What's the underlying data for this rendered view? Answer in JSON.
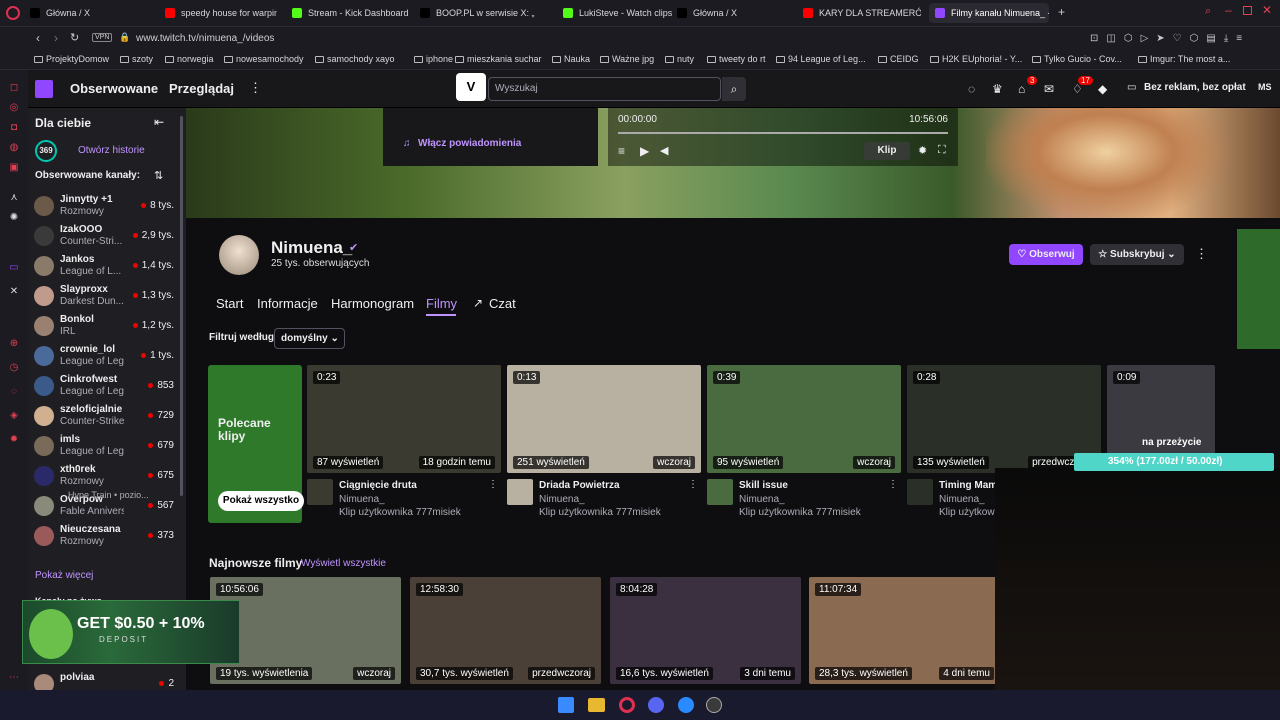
{
  "tabs": [
    {
      "label": "Główna / X",
      "color": "#000000"
    },
    {
      "label": "speedy house for warpin",
      "color": "#ff0000"
    },
    {
      "label": "Stream - Kick Dashboard",
      "color": "#53fc18"
    },
    {
      "label": "BOOP.PL w serwisie X: „",
      "color": "#000000"
    },
    {
      "label": "LukiSteve - Watch clips o",
      "color": "#53fc18"
    },
    {
      "label": "Główna / X",
      "color": "#000000"
    },
    {
      "label": "KARY DLA STREAMERÓW",
      "color": "#ff0000"
    },
    {
      "label": "Filmy kanału Nimuena_ - T",
      "color": "#9147ff"
    }
  ],
  "address": {
    "vpn": "VPN",
    "url": "www.twitch.tv/nimuena_/videos"
  },
  "bookmarks": [
    "ProjektyDomow",
    "szoty",
    "norwegia",
    "nowesamochody",
    "samochody xayo",
    "iphone",
    "mieszkania suchar",
    "Nauka",
    "Ważne jpg",
    "nuty",
    "tweety do rt",
    "94 League of Leg...",
    "CEIDG",
    "H2K EUphoria! - Y...",
    "Tylko Gucio - Cov...",
    "Imgur: The most a..."
  ],
  "nav": {
    "followed": "Obserwowane",
    "browse": "Przeglądaj",
    "search_placeholder": "Wyszukaj",
    "notif_count1": "3",
    "notif_count2": "17",
    "adfree": "Bez reklam, bez opłat",
    "user": "MS"
  },
  "sidebar": {
    "for_you": "Dla ciebie",
    "streak": "369",
    "history": "Otwórz historie",
    "followed_channels": "Obserwowane kanały:",
    "channels": [
      {
        "name": "Jinnytty +1",
        "game": "Rozmowy",
        "viewers": "8 tys.",
        "color": "#6b5a4a"
      },
      {
        "name": "IzakOOO",
        "game": "Counter-Stri...",
        "viewers": "2,9 tys.",
        "color": "#3a3a3a"
      },
      {
        "name": "Jankos",
        "game": "League of L...",
        "viewers": "1,4 tys.",
        "color": "#8a7a6a"
      },
      {
        "name": "Slayproxx",
        "game": "Darkest Dun...",
        "viewers": "1,3 tys.",
        "color": "#c09a8a"
      },
      {
        "name": "Bonkol",
        "game": "IRL",
        "viewers": "1,2 tys.",
        "color": "#9a8070"
      },
      {
        "name": "crownie_lol",
        "game": "League of Leg...",
        "viewers": "1 tys.",
        "color": "#4a6a9a"
      },
      {
        "name": "Cinkrofwest",
        "game": "League of Lege...",
        "viewers": "853",
        "color": "#3a5a8a"
      },
      {
        "name": "szeloficjalnie",
        "game": "Counter-Strike",
        "viewers": "729",
        "color": "#d0b090"
      },
      {
        "name": "imls",
        "game": "League of Lege...",
        "viewers": "679",
        "color": "#7a6a5a"
      },
      {
        "name": "xth0rek",
        "game": "Rozmowy",
        "viewers": "675",
        "color": "#2a2a6a"
      },
      {
        "name": "Overpow",
        "game": "Fable Annivers...",
        "viewers": "567",
        "color": "#8a8a7a"
      },
      {
        "name": "Nieuczesana",
        "game": "Rozmowy",
        "viewers": "373",
        "color": "#9a5a5a"
      }
    ],
    "hype": "Hype Train • pozio...",
    "show_more": "Pokaż więcej",
    "live_label": "Kanały na żywo",
    "last_channel": {
      "name": "polviaa",
      "game": "League of Lege...",
      "viewers": "2"
    }
  },
  "player": {
    "notify": "Włącz powiadomienia",
    "time_start": "00:00:00",
    "time_end": "10:56:06",
    "clip": "Klip"
  },
  "channel": {
    "name": "Nimuena_",
    "followers": "25 tys. obserwujących",
    "follow": "Obserwuj",
    "subscribe": "Subskrybuj",
    "tabs": [
      "Start",
      "Informacje",
      "Harmonogram",
      "Filmy",
      "Czat"
    ],
    "filter_label": "Filtruj według",
    "filter_value": "domyślny"
  },
  "featured": {
    "title": "Polecane klipy",
    "show_all": "Pokaż wszystko"
  },
  "clips": [
    {
      "dur": "0:23",
      "views": "87 wyświetleń",
      "ago": "18 godzin temu",
      "title": "Ciągnięcie druta",
      "author": "Nimuena_",
      "by": "Klip użytkownika 777misiek",
      "color": "#3a3a30"
    },
    {
      "dur": "0:13",
      "views": "251 wyświetleń",
      "ago": "wczoraj",
      "title": "Driada Powietrza",
      "author": "Nimuena_",
      "by": "Klip użytkownika 777misiek",
      "color": "#b8b0a0"
    },
    {
      "dur": "0:39",
      "views": "95 wyświetleń",
      "ago": "wczoraj",
      "title": "Skill issue",
      "author": "Nimuena_",
      "by": "Klip użytkownika 777misiek",
      "color": "#4a6a40"
    },
    {
      "dur": "0:28",
      "views": "135 wyświetleń",
      "ago": "przedwczoraj",
      "title": "Timing Mam",
      "author": "Nimuena_",
      "by": "Klip użytkow",
      "color": "#2a3028"
    },
    {
      "dur": "0:09",
      "views": "",
      "ago": "",
      "title": "",
      "author": "",
      "by": "",
      "color": "#3a3a40"
    }
  ],
  "newest": {
    "title": "Najnowsze filmy",
    "view_all": "Wyświetl wszystkie"
  },
  "videos": [
    {
      "dur": "10:56:06",
      "views": "19 tys. wyświetlenia",
      "ago": "wczoraj",
      "color": "#6a7060"
    },
    {
      "dur": "12:58:30",
      "views": "30,7 tys. wyświetleń",
      "ago": "przedwczoraj",
      "color": "#4a4038"
    },
    {
      "dur": "8:04:28",
      "views": "16,6 tys. wyświetleń",
      "ago": "3 dni temu",
      "color": "#3a3040"
    },
    {
      "dur": "11:07:34",
      "views": "28,3 tys. wyświetleń",
      "ago": "4 dni temu",
      "color": "#8a6a50"
    }
  ],
  "overlay": {
    "banner": "GET $0.50 + 10%",
    "banner_sub": "DEPOSIT",
    "progress": "354% (177.00zł / 50.00zł)",
    "na_przezycie": "na przeżycie"
  }
}
